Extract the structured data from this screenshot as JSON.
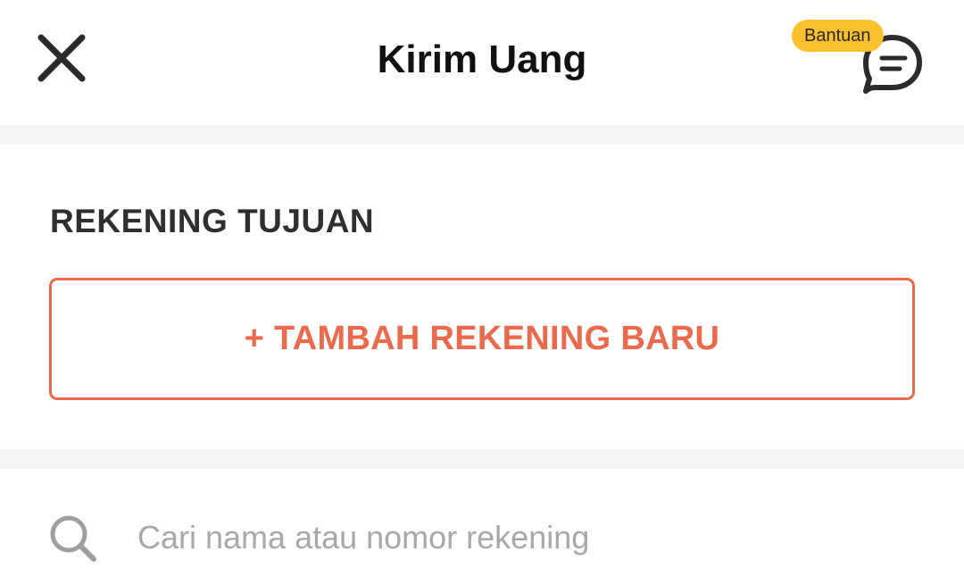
{
  "header": {
    "title": "Kirim Uang",
    "close_icon": "close-icon",
    "help": {
      "badge_label": "Bantuan",
      "icon": "chat-bubble-icon",
      "badge_color": "#fbc02d"
    }
  },
  "section": {
    "heading": "REKENING TUJUAN",
    "add_button_label": "+ TAMBAH REKENING BARU",
    "accent_color": "#ec6a4c"
  },
  "search": {
    "icon": "search-icon",
    "placeholder": "Cari nama atau nomor rekening",
    "value": ""
  }
}
